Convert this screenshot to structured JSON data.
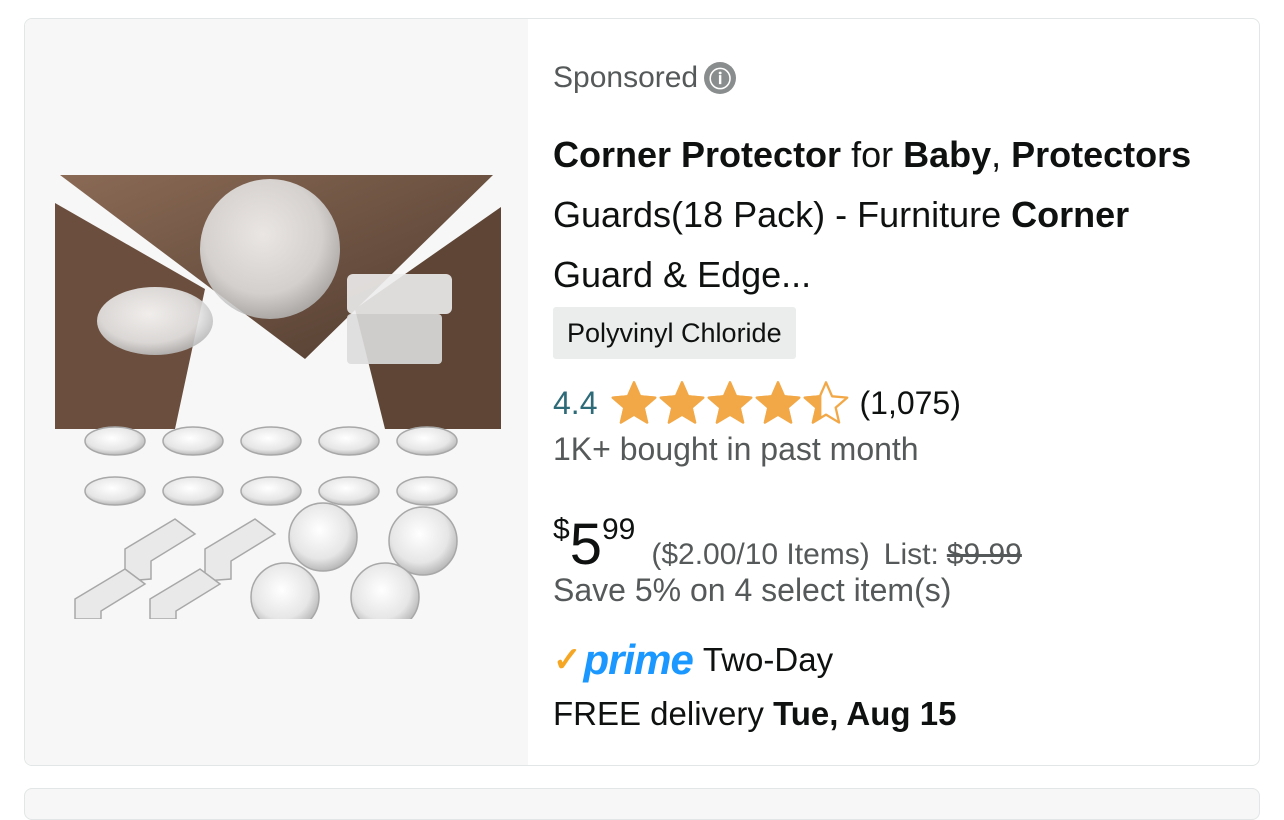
{
  "sponsored": {
    "label": "Sponsored",
    "info_icon": "ⓘ"
  },
  "product": {
    "title_parts": [
      {
        "text": "Corner Protector",
        "bold": true
      },
      {
        "text": " for ",
        "bold": false
      },
      {
        "text": "Baby",
        "bold": true
      },
      {
        "text": ", ",
        "bold": false
      },
      {
        "text": "Protectors",
        "bold": true
      },
      {
        "text": " Guards(18 Pack) - Furniture ",
        "bold": false
      },
      {
        "text": "Corner",
        "bold": true
      },
      {
        "text": " Guard & Edge...",
        "bold": false
      }
    ],
    "material_badge": "Polyvinyl Chloride",
    "image_icon": "corner-protector-product-photo"
  },
  "rating": {
    "value": "4.4",
    "stars": 4.4,
    "count": "(1,075)",
    "star_color": "#f3a847"
  },
  "bought": "1K+ bought in past month",
  "price": {
    "symbol": "$",
    "whole": "5",
    "fraction": "99",
    "unit": "($2.00/10 Items)",
    "list_label": "List:",
    "list_price": "$9.99"
  },
  "save": "Save 5% on 4 select item(s)",
  "prime": {
    "check": "✓",
    "word": "prime",
    "label": "Two-Day",
    "color": "#1a98ff"
  },
  "delivery": {
    "prefix": "FREE delivery ",
    "date": "Tue, Aug 15"
  }
}
